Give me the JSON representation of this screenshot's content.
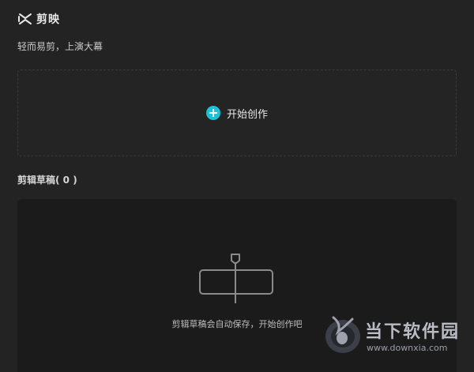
{
  "app": {
    "name": "剪映",
    "slogan": "轻而易剪，上演大幕"
  },
  "create": {
    "label": "开始创作"
  },
  "drafts": {
    "title": "剪辑草稿( 0 )",
    "empty_text": "剪辑草稿会自动保存，开始创作吧"
  },
  "watermark": {
    "title": "当下软件园",
    "url": "www.downxia.com"
  },
  "colors": {
    "accent": "#19c2d4",
    "background": "#232323",
    "panel": "#1b1b1b"
  },
  "icons": {
    "logo": "capcut-logo-icon",
    "create": "plus-circle-icon",
    "empty": "empty-draft-timeline-icon",
    "watermark": "downxia-logo-icon"
  }
}
